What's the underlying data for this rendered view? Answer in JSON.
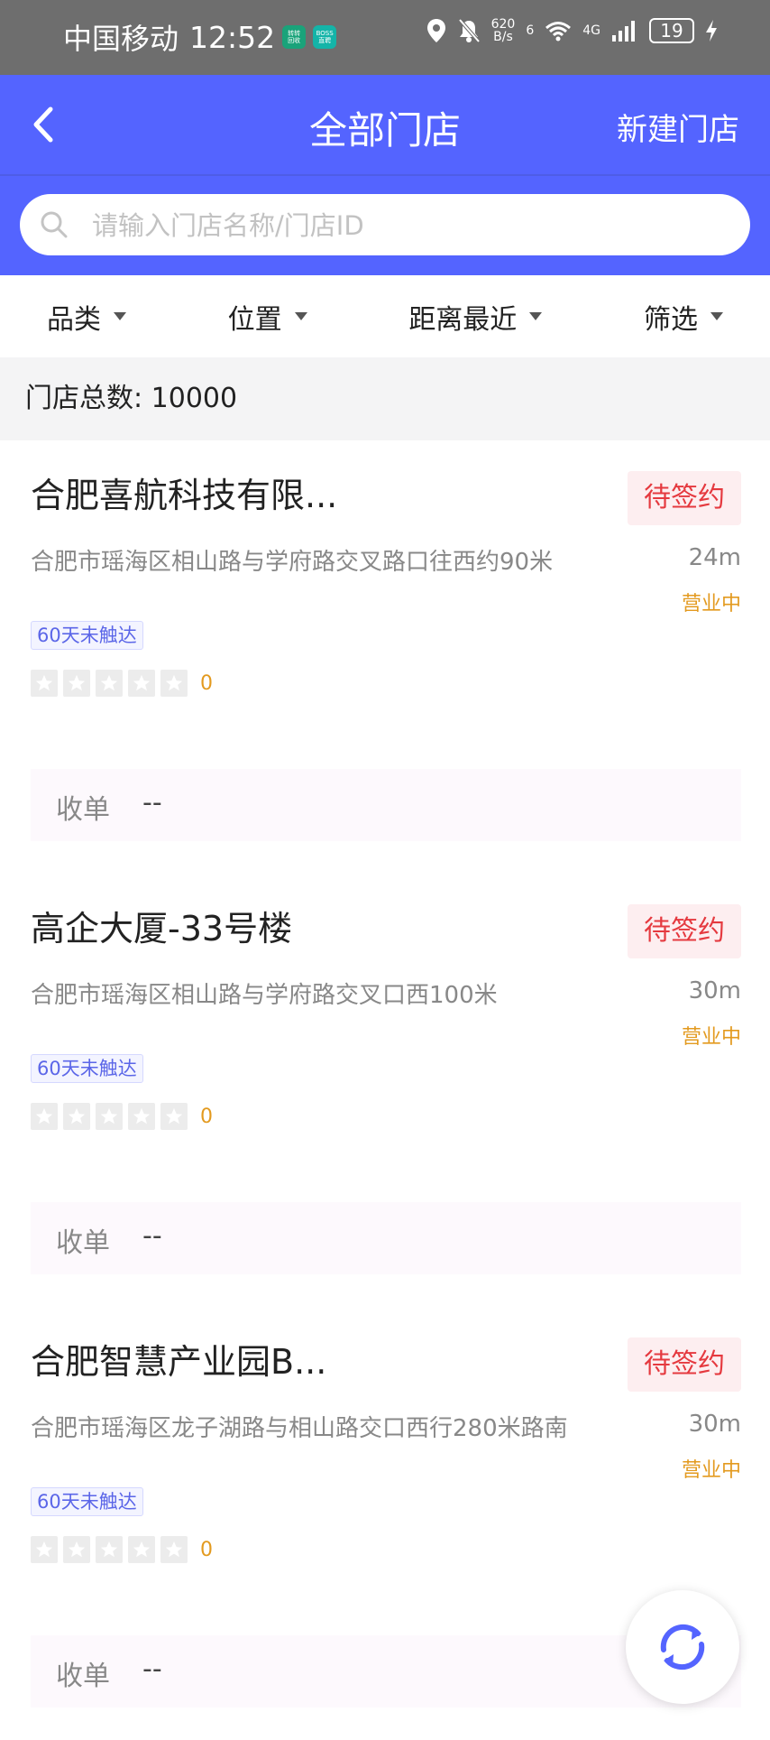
{
  "status_bar": {
    "carrier": "中国移动",
    "time": "12:52",
    "badge1": "转转\n回收",
    "badge2": "BOSS\n直聘",
    "net_speed_value": "620",
    "net_speed_unit": "B/s",
    "sig_6": "6",
    "sig_4g": "4G",
    "battery": "19"
  },
  "header": {
    "title": "全部门店",
    "new_store": "新建门店"
  },
  "search": {
    "placeholder": "请输入门店名称/门店ID"
  },
  "filters": {
    "category": "品类",
    "location": "位置",
    "distance": "距离最近",
    "filter": "筛选"
  },
  "total": {
    "text": "门店总数: 10000"
  },
  "stores": [
    {
      "name": "合肥喜航科技有限...",
      "status": "待签约",
      "address": "合肥市瑶海区相山路与学府路交叉路口往西约90米",
      "distance": "24m",
      "open": "营业中",
      "tag": "60天未触达",
      "rating": "0",
      "order_label": "收单",
      "order_value": "--"
    },
    {
      "name": "高企大厦-33号楼",
      "status": "待签约",
      "address": "合肥市瑶海区相山路与学府路交叉口西100米",
      "distance": "30m",
      "open": "营业中",
      "tag": "60天未触达",
      "rating": "0",
      "order_label": "收单",
      "order_value": "--"
    },
    {
      "name": "合肥智慧产业园B...",
      "status": "待签约",
      "address": "合肥市瑶海区龙子湖路与相山路交口西行280米路南",
      "distance": "30m",
      "open": "营业中",
      "tag": "60天未触达",
      "rating": "0",
      "order_label": "收单",
      "order_value": "--"
    }
  ],
  "colors": {
    "primary": "#5464ff",
    "status_red": "#e5393f",
    "open_orange": "#e39a1f"
  }
}
